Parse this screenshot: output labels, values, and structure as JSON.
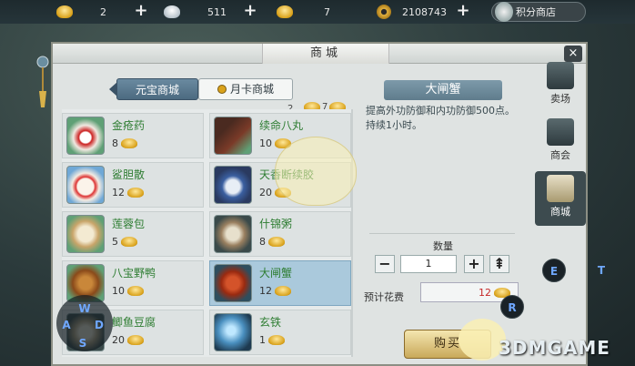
{
  "resources": {
    "gold_count": "2",
    "silver_count": "511",
    "ticket_count": "7",
    "coins": "2108743",
    "points_shop_label": "积分商店"
  },
  "window": {
    "title": "商城",
    "close": "×"
  },
  "tabs": [
    {
      "label": "元宝商城"
    },
    {
      "label": "月卡商城"
    }
  ],
  "month_card_ticket": "7",
  "items": [
    {
      "name": "金疮药",
      "price": "8"
    },
    {
      "name": "续命八丸",
      "price": "10"
    },
    {
      "name": "鲨胆散",
      "price": "12"
    },
    {
      "name": "天香断续胶",
      "price": "20"
    },
    {
      "name": "莲蓉包",
      "price": "5"
    },
    {
      "name": "什锦粥",
      "price": "8"
    },
    {
      "name": "八宝野鸭",
      "price": "10"
    },
    {
      "name": "大闸蟹",
      "price": "12"
    },
    {
      "name": "鲫鱼豆腐",
      "price": "20"
    },
    {
      "name": "玄铁",
      "price": "1"
    }
  ],
  "top_row_price": "2",
  "detail": {
    "name": "大闸蟹",
    "description": "提高外功防御和内功防御500点。持续1小时。",
    "qty_label": "数量",
    "qty_value": "1",
    "minus": "−",
    "plus": "+",
    "max": "⇞",
    "cost_label": "预计花费",
    "cost_value": "12",
    "buy_label": "购买"
  },
  "sidebar": [
    {
      "label": "卖场"
    },
    {
      "label": "商会"
    },
    {
      "label": "商城"
    }
  ],
  "keys": {
    "e": "E",
    "t": "T",
    "r": "R",
    "w": "W",
    "a": "A",
    "d": "D",
    "s": "S"
  },
  "watermark": "3DMGAME",
  "colors": {
    "item_name": "#2e7d32",
    "cost": "#c62828",
    "selected": "#aac9dc"
  }
}
